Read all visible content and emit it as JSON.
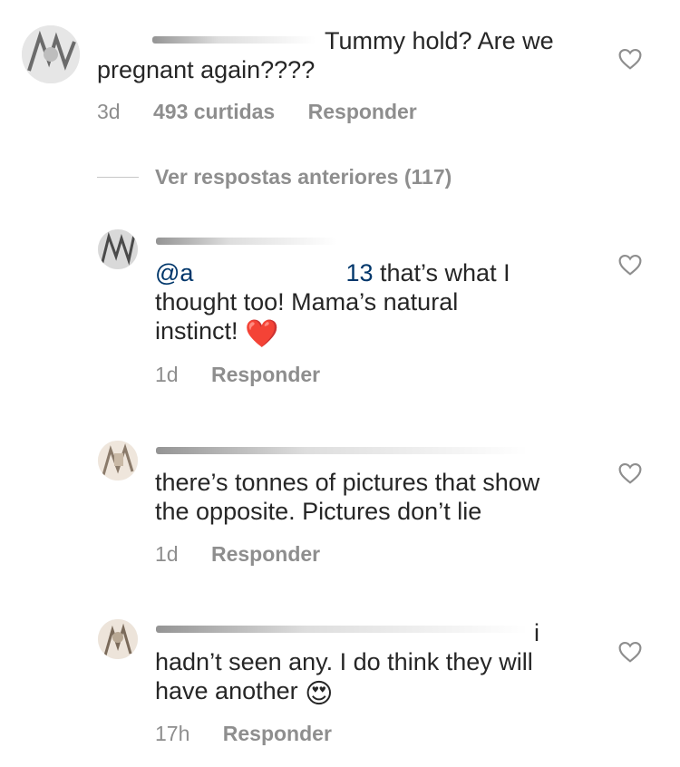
{
  "comments": [
    {
      "text_visible": "Tummy hold? Are we",
      "text_line2": "pregnant again????",
      "time": "3d",
      "likes": "493 curtidas",
      "reply": "Responder"
    },
    {
      "mention_visible": "@a",
      "mention_tail": "13",
      "text_line1_after": "that’s what I",
      "text_line2": "thought too!  Mama’s natural",
      "text_line3": "instinct!",
      "emoji": "❤️",
      "time": "1d",
      "reply": "Responder"
    },
    {
      "text_line1": "there’s tonnes of pictures that show",
      "text_line2": "the opposite. Pictures don’t lie",
      "time": "1d",
      "reply": "Responder"
    },
    {
      "text_line1_start": "i",
      "text_line2": "hadn’t seen any.  I do think they will",
      "text_line3": "have another",
      "emoji": "😍",
      "time": "17h",
      "reply": "Responder"
    }
  ],
  "view_previous": "Ver respostas anteriores (117)",
  "icons": {
    "heart": "heart-outline-icon",
    "avatar": "avatar"
  },
  "colors": {
    "text": "#262626",
    "meta": "#8e8e8e",
    "mention": "#00376b",
    "heart_stroke": "#8e8e8e"
  }
}
